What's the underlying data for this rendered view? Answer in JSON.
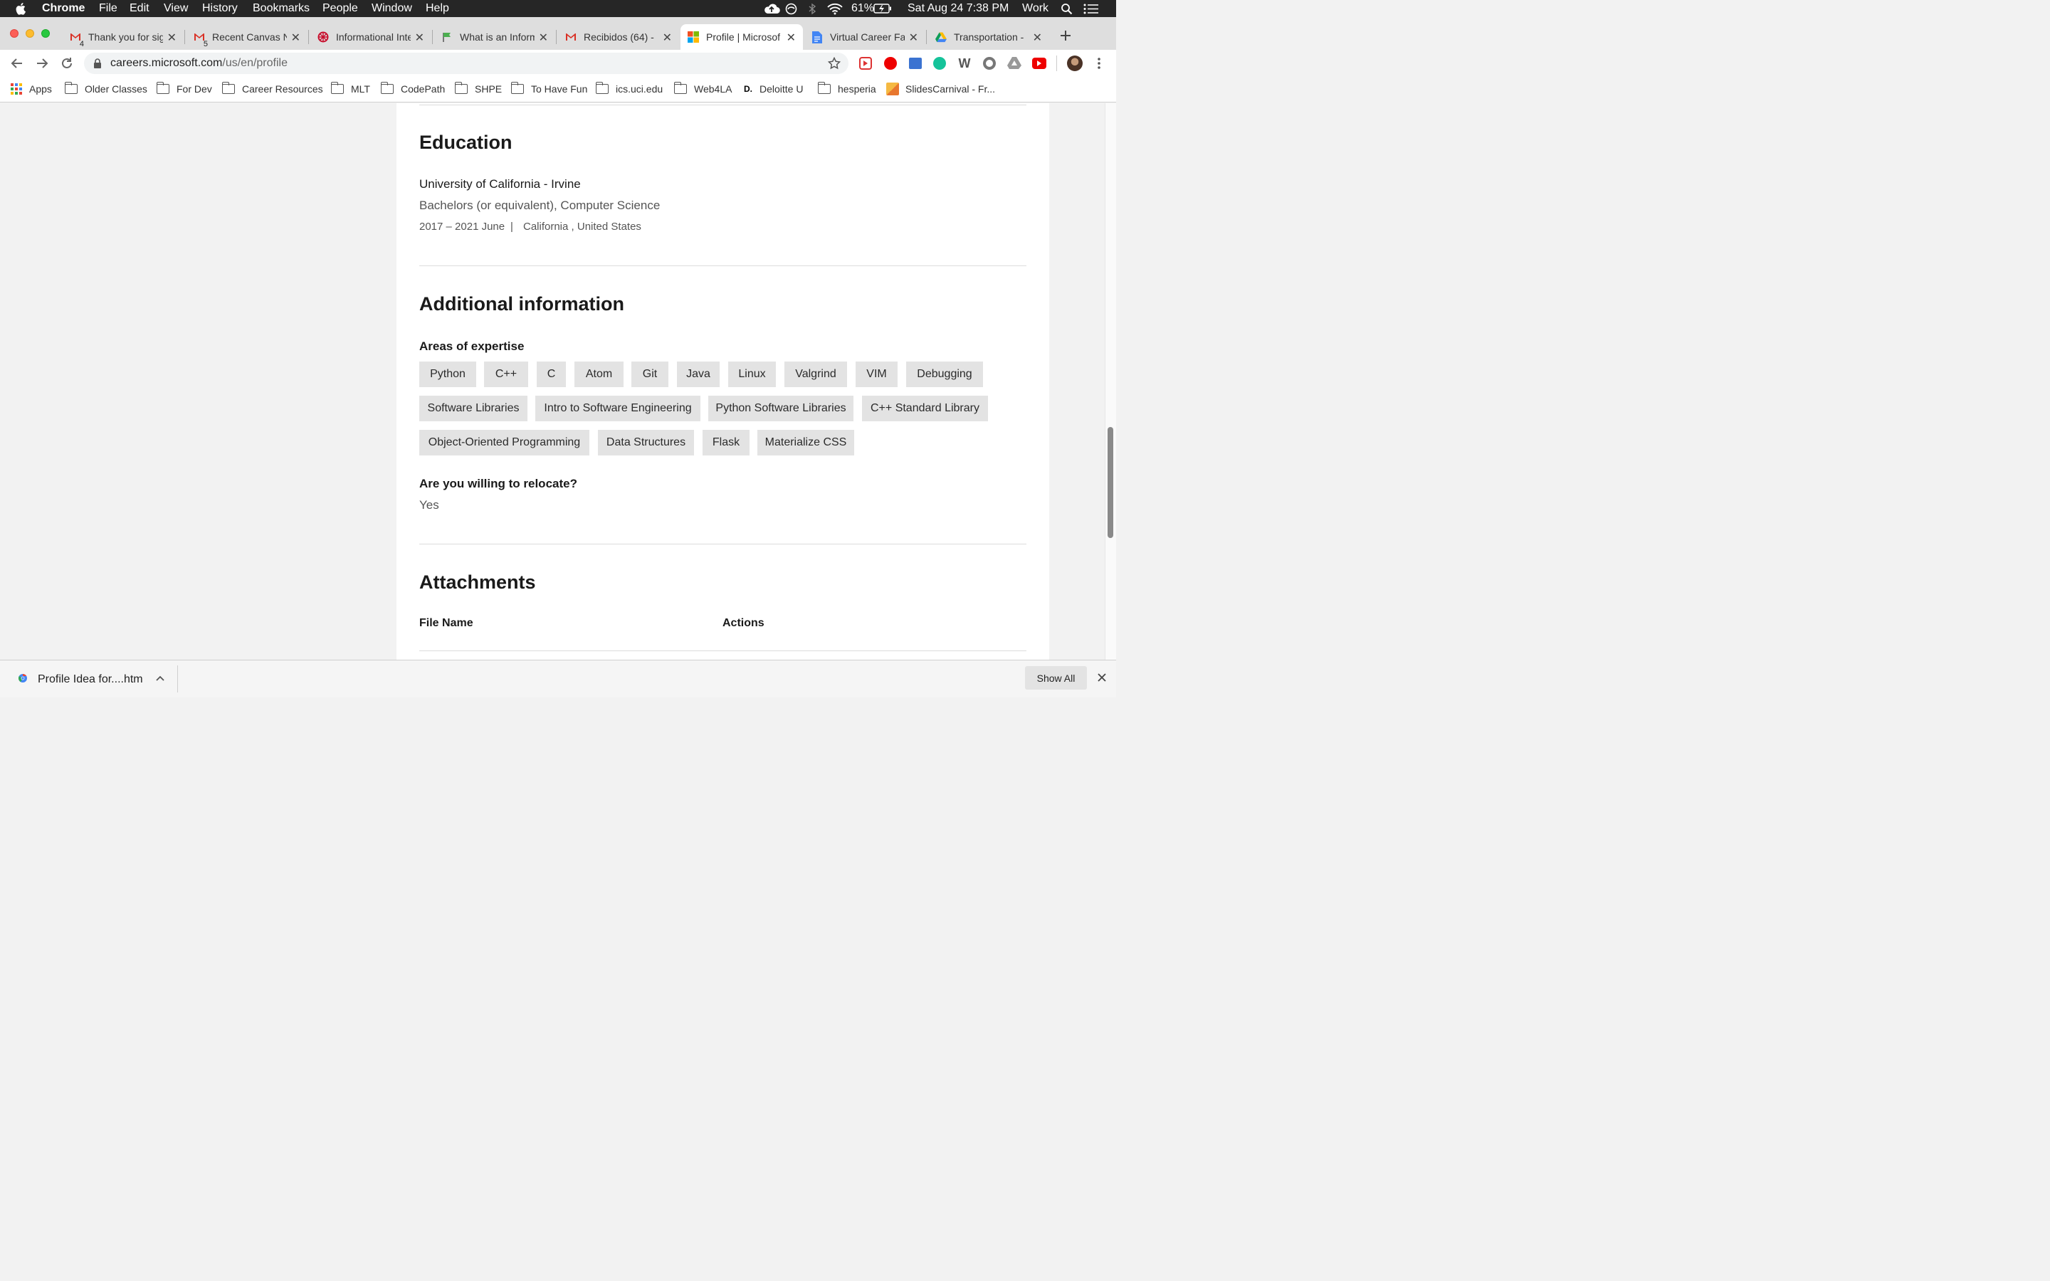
{
  "menubar": {
    "app": "Chrome",
    "items": [
      "File",
      "Edit",
      "View",
      "History",
      "Bookmarks",
      "People",
      "Window",
      "Help"
    ],
    "battery": "61%",
    "datetime": "Sat Aug 24  7:38 PM",
    "profile": "Work"
  },
  "tabs": [
    {
      "title": "Thank you for sig",
      "icon": "gmail-icon",
      "badge": "4"
    },
    {
      "title": "Recent Canvas N",
      "icon": "gmail-icon",
      "badge": "5"
    },
    {
      "title": "Informational Inte",
      "icon": "red-asterisk-icon"
    },
    {
      "title": "What is an Inform",
      "icon": "green-flag-icon"
    },
    {
      "title": "Recibidos (64) -",
      "icon": "gmail-icon"
    },
    {
      "title": "Profile | Microsof",
      "icon": "microsoft-icon",
      "active": true
    },
    {
      "title": "Virtual Career Fa",
      "icon": "docs-icon"
    },
    {
      "title": "Transportation -",
      "icon": "drive-icon"
    }
  ],
  "address": {
    "host": "careers.microsoft.com",
    "path": "/us/en/profile"
  },
  "bookmarks": [
    {
      "label": "Apps",
      "icon": "apps-grid-icon"
    },
    {
      "label": "Older Classes",
      "icon": "folder-icon"
    },
    {
      "label": "For Dev",
      "icon": "folder-icon"
    },
    {
      "label": "Career Resources",
      "icon": "folder-icon"
    },
    {
      "label": "MLT",
      "icon": "folder-icon"
    },
    {
      "label": "CodePath",
      "icon": "folder-icon"
    },
    {
      "label": "SHPE",
      "icon": "folder-icon"
    },
    {
      "label": "To Have Fun",
      "icon": "folder-icon"
    },
    {
      "label": "ics.uci.edu",
      "icon": "folder-icon"
    },
    {
      "label": "Web4LA",
      "icon": "folder-icon"
    },
    {
      "label": "Deloitte U",
      "icon": "deloitte-icon",
      "icon_text": "D."
    },
    {
      "label": "hesperia",
      "icon": "folder-icon"
    },
    {
      "label": "SlidesCarnival - Fr...",
      "icon": "slidescarnival-icon"
    }
  ],
  "education": {
    "heading": "Education",
    "school": "University of California - Irvine",
    "degree": "Bachelors (or equivalent), Computer Science",
    "dates": "2017 – 2021 June",
    "separator": "|",
    "location": "California , United States"
  },
  "additional": {
    "heading": "Additional information",
    "expertise_label": "Areas of expertise",
    "skills": [
      "Python",
      "C++",
      "C",
      "Atom",
      "Git",
      "Java",
      "Linux",
      "Valgrind",
      "VIM",
      "Debugging",
      "Software Libraries",
      "Intro to Software Engineering",
      "Python Software Libraries",
      "C++ Standard Library",
      "Object-Oriented Programming",
      "Data Structures",
      "Flask",
      "Materialize CSS"
    ],
    "relocate_label": "Are you willing to relocate?",
    "relocate_value": "Yes"
  },
  "attachments": {
    "heading": "Attachments",
    "col_file": "File Name",
    "col_actions": "Actions"
  },
  "download": {
    "file": "Profile Idea for....htm",
    "show_all": "Show All"
  },
  "colors": {
    "menubar": "#262626",
    "chip": "#e3e3e3",
    "page_bg": "#f2f2f2"
  }
}
